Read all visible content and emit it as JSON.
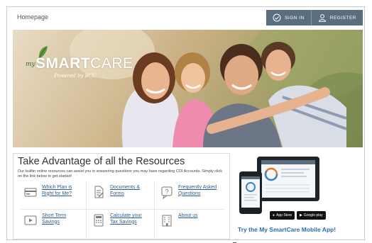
{
  "topbar": {
    "home_label": "Homepage",
    "sign_in_label": "SIGN IN",
    "register_label": "REGISTER"
  },
  "hero": {
    "logo_prefix": "my",
    "logo_smart": "SMART",
    "logo_care": "CARE",
    "logo_powered": "Powered by BCC"
  },
  "resources": {
    "title": "Take Advantage of all the Resources",
    "description": "Our builtin online resources can assist you in answering questions you may have regarding CDI Accounts. Simply click on the link below to get started!",
    "items": [
      {
        "label": "Which Plan is Right for Me?",
        "icon": "credit-card-icon"
      },
      {
        "label": "Documents & Forms",
        "icon": "document-icon"
      },
      {
        "label": "Frequently Asked Questions",
        "icon": "faq-question-icon"
      },
      {
        "label": "Short Term Savings",
        "icon": "video-player-icon"
      },
      {
        "label": "Calculate your Tax Savings",
        "icon": "calculator-icon"
      },
      {
        "label": "About us",
        "icon": "building-icon"
      }
    ]
  },
  "mobile": {
    "app_store_label": "App Store",
    "google_play_label": "Google play",
    "cta_label": "Try the My SmartCare Mobile App!"
  },
  "colors": {
    "auth_bar": "#5b6e80",
    "link_blue": "#2b5d8a",
    "cta_blue": "#2b6db0",
    "logo_green": "#3a6c33"
  }
}
